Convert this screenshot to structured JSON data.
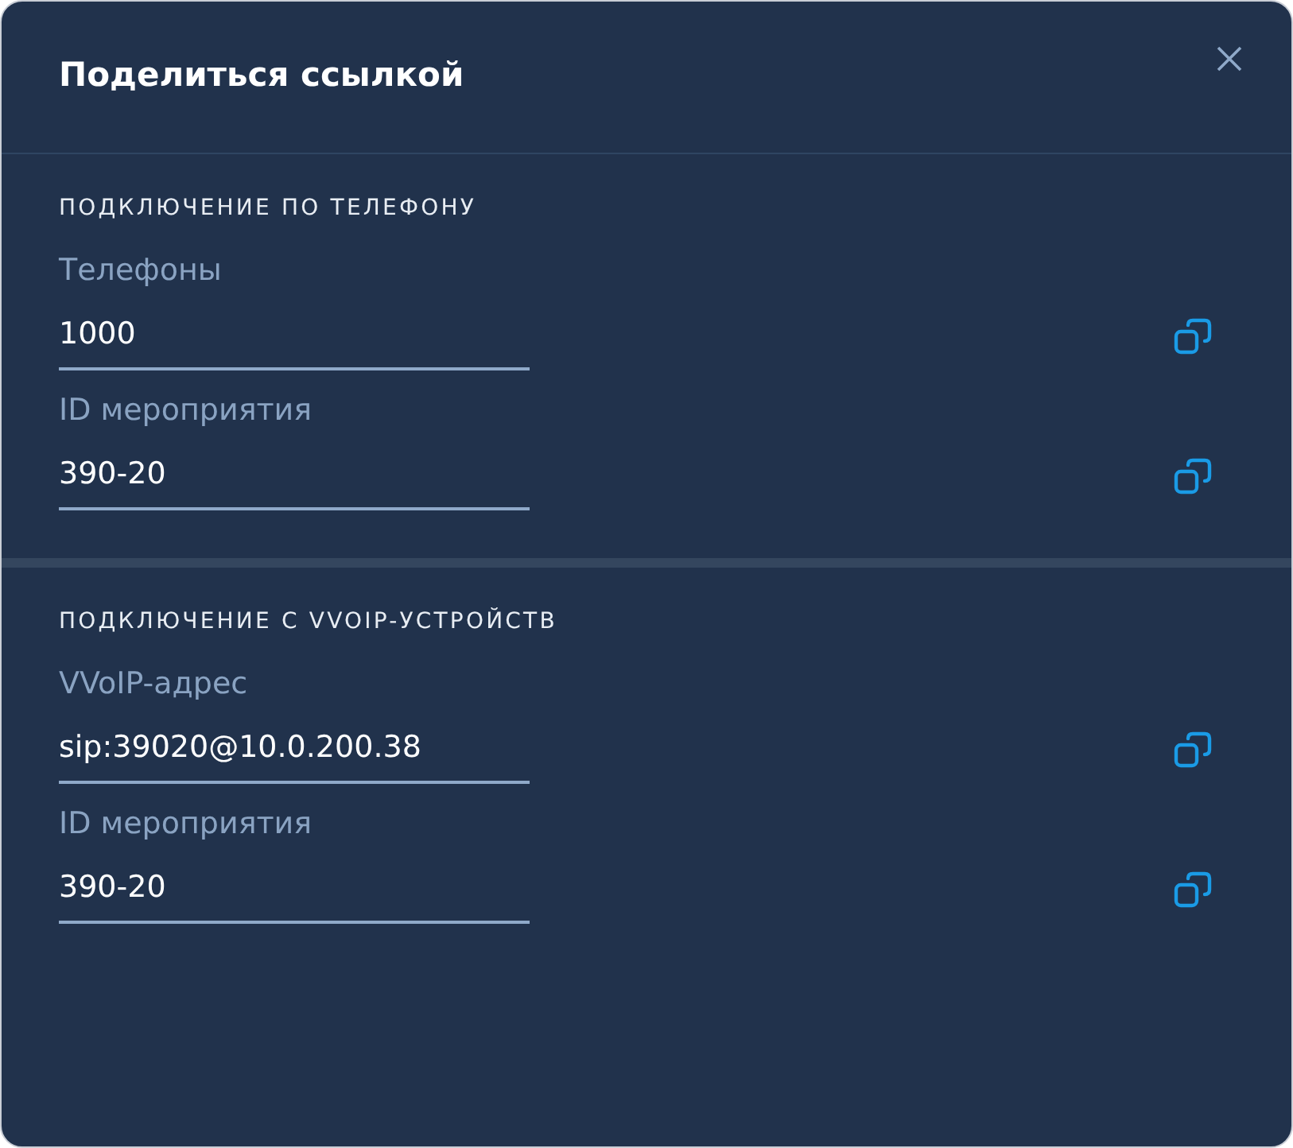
{
  "dialog": {
    "title": "Поделиться ссылкой"
  },
  "sections": [
    {
      "heading": "ПОДКЛЮЧЕНИЕ ПО ТЕЛЕФОНУ",
      "fields": [
        {
          "label": "Телефоны",
          "value": "1000"
        },
        {
          "label": "ID мероприятия",
          "value": "390-20"
        }
      ]
    },
    {
      "heading": "ПОДКЛЮЧЕНИЕ С VVOIP-УСТРОЙСТВ",
      "fields": [
        {
          "label": "VVoIP-адрес",
          "value": "sip:39020@10.0.200.38"
        },
        {
          "label": "ID мероприятия",
          "value": "390-20"
        }
      ]
    }
  ]
}
